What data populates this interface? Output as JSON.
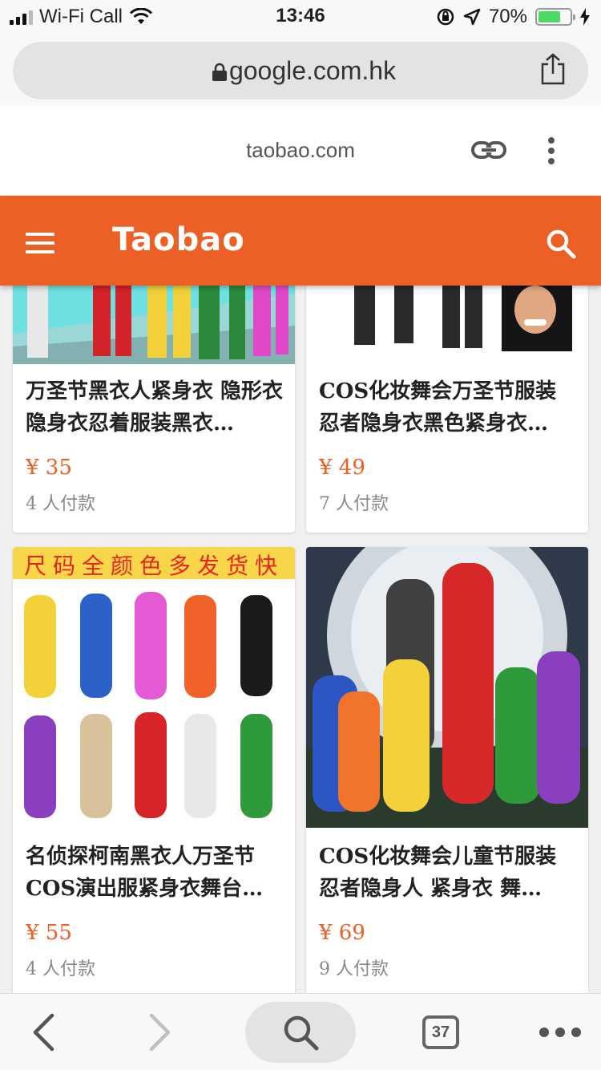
{
  "status_bar": {
    "carrier": "Wi-Fi Call",
    "time": "13:46",
    "battery": "70%",
    "battery_level": 0.7
  },
  "browser": {
    "url": "google.com.hk",
    "site_domain": "taobao.com",
    "tab_count": "37"
  },
  "site": {
    "title": "Taobao",
    "accent_color": "#ec5f25"
  },
  "products": [
    {
      "title": "万圣节黑衣人紧身衣 隐形衣 隐身衣忍着服装黑衣…",
      "price": "¥ 35",
      "sold": "4 人付款"
    },
    {
      "title": "COS化妆舞会万圣节服装忍者隐身衣黑色紧身衣…",
      "price": "¥ 49",
      "sold": "7 人付款"
    },
    {
      "title": "名侦探柯南黑衣人万圣节COS演出服紧身衣舞台…",
      "price": "¥ 55",
      "sold": "4 人付款",
      "banner": "尺码全颜色多发货快"
    },
    {
      "title": "COS化妆舞会儿童节服装忍者隐身人 紧身衣 舞…",
      "price": "¥ 69",
      "sold": "9 人付款"
    }
  ]
}
